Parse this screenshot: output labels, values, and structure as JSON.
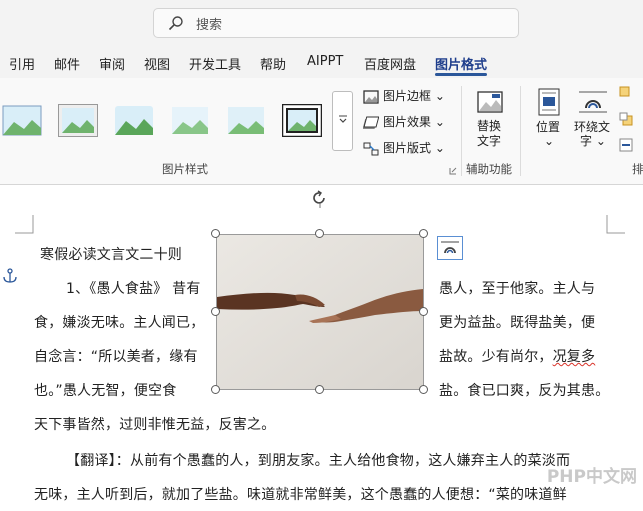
{
  "search": {
    "placeholder": "搜索"
  },
  "menu_tabs": [
    "引用",
    "邮件",
    "审阅",
    "视图",
    "开发工具",
    "帮助",
    "AIPPT",
    "百度网盘",
    "图片格式"
  ],
  "active_tab": "图片格式",
  "ribbon": {
    "picture_border": "图片边框",
    "picture_effects": "图片效果",
    "picture_layout": "图片版式",
    "group_picture_styles": "图片样式",
    "alt_text": [
      "替换",
      "文字"
    ],
    "group_accessibility": "辅助功能",
    "position": "位置",
    "wrap_text": [
      "环绕文",
      "字"
    ],
    "group_arrange_partial": "排"
  },
  "document": {
    "title": "寒假必读文言文二十则",
    "p1_left": [
      "1、《愚人食盐》 昔有",
      "食，嫌淡无味。主人闻已，",
      "自念言：“所以美者，缘有",
      "也。”愚人无智，便空食"
    ],
    "p1_right": [
      "愚人，至于他家。主人与",
      "更为益盐。既得盐美，便",
      "盐故。少有尚尔，",
      "况复多",
      "盐。食已口爽，反为其患。"
    ],
    "p1_last": "天下事皆然，过则非惟无益，反害之。",
    "p2_line1": "【翻译】：从前有个愚蠢的人，到朋友家。主人给他食物，这人嫌弃主人的菜淡而",
    "p2_line2": "无味，主人听到后，就加了些盐。味道就非常鲜美，这个愚蠢的人便想：“菜的味道鲜"
  },
  "watermark": "PHP中文网",
  "colors": {
    "accent": "#2b579a",
    "active_tab_text": "#1f3e8c"
  }
}
